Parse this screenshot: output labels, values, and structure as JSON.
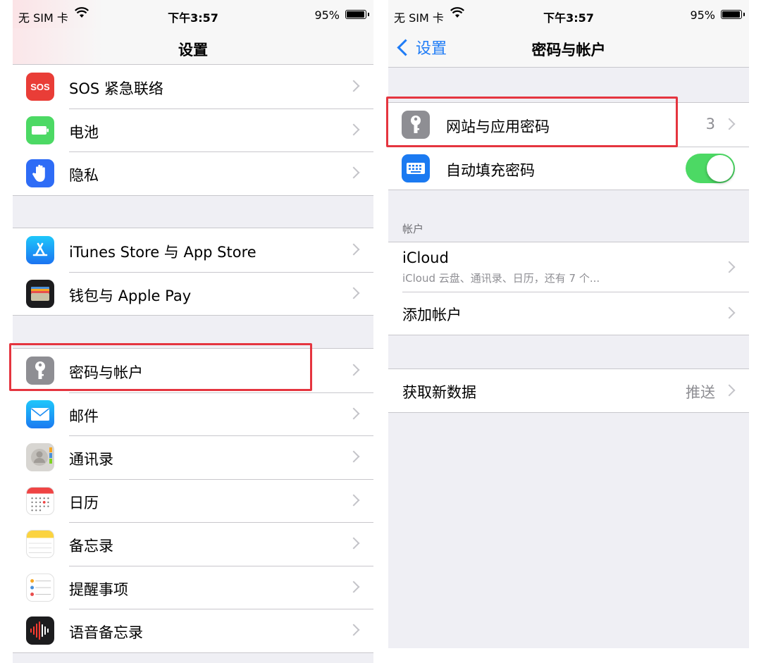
{
  "left": {
    "status": {
      "carrier": "无 SIM 卡",
      "time": "下午3:57",
      "battery_pct": "95%",
      "battery_level": 0.95
    },
    "nav": {
      "title": "设置"
    },
    "group1": [
      {
        "label": "SOS 紧急联络",
        "icon": "sos-icon"
      },
      {
        "label": "电池",
        "icon": "battery-icon"
      },
      {
        "label": "隐私",
        "icon": "hand-icon"
      }
    ],
    "group2": [
      {
        "label": "iTunes Store 与 App Store",
        "icon": "app-store-icon"
      },
      {
        "label": "钱包与 Apple Pay",
        "icon": "wallet-icon"
      }
    ],
    "group3": [
      {
        "label": "密码与帐户",
        "icon": "key-icon"
      },
      {
        "label": "邮件",
        "icon": "mail-icon"
      },
      {
        "label": "通讯录",
        "icon": "contacts-icon"
      },
      {
        "label": "日历",
        "icon": "calendar-icon"
      },
      {
        "label": "备忘录",
        "icon": "notes-icon"
      },
      {
        "label": "提醒事项",
        "icon": "reminders-icon"
      },
      {
        "label": "语音备忘录",
        "icon": "voice-memos-icon"
      }
    ]
  },
  "right": {
    "status": {
      "carrier": "无 SIM 卡",
      "time": "下午3:57",
      "battery_pct": "95%",
      "battery_level": 0.95
    },
    "nav": {
      "back": "设置",
      "title": "密码与帐户"
    },
    "passwords": [
      {
        "label": "网站与应用密码",
        "detail": "3",
        "icon": "key-icon"
      },
      {
        "label": "自动填充密码",
        "icon": "keyboard-icon",
        "toggle_on": true
      }
    ],
    "accounts_header": "帐户",
    "icloud": {
      "label": "iCloud",
      "sub": "iCloud 云盘、通讯录、日历，还有 7 个..."
    },
    "add_account": "添加帐户",
    "fetch": {
      "label": "获取新数据",
      "detail": "推送"
    }
  },
  "colors": {
    "highlight": "#e5353f",
    "toggle_on": "#4cd964",
    "link": "#1f7cf6"
  }
}
